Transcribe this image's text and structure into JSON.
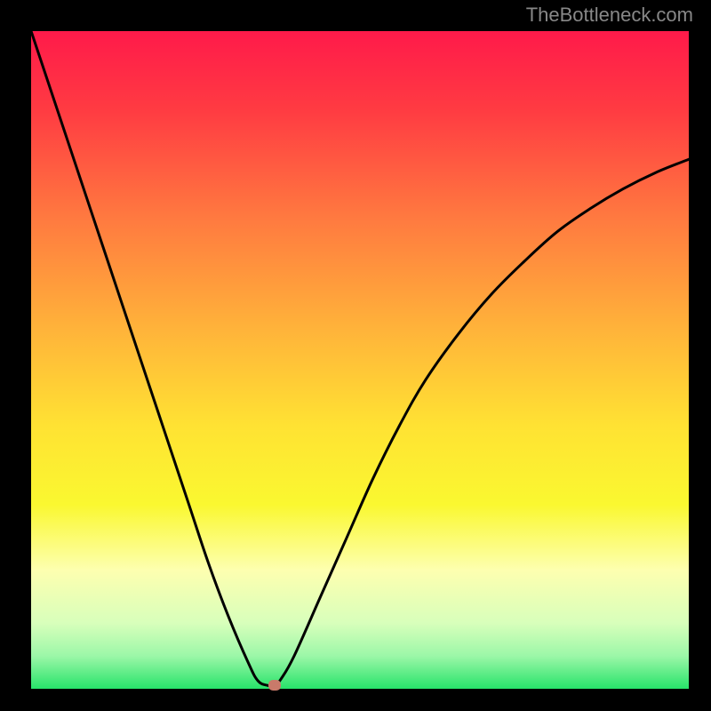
{
  "watermark": "TheBottleneck.com",
  "chart_data": {
    "type": "line",
    "title": "",
    "xlabel": "",
    "ylabel": "",
    "xlim": [
      0,
      100
    ],
    "ylim": [
      0,
      100
    ],
    "gradient_stops": [
      {
        "pos": 0.0,
        "color": "#ff1a4a"
      },
      {
        "pos": 0.12,
        "color": "#ff3b42"
      },
      {
        "pos": 0.28,
        "color": "#ff7840"
      },
      {
        "pos": 0.45,
        "color": "#ffb23a"
      },
      {
        "pos": 0.6,
        "color": "#ffe233"
      },
      {
        "pos": 0.72,
        "color": "#faf830"
      },
      {
        "pos": 0.82,
        "color": "#fdffb0"
      },
      {
        "pos": 0.9,
        "color": "#d8ffbb"
      },
      {
        "pos": 0.95,
        "color": "#9cf7a8"
      },
      {
        "pos": 1.0,
        "color": "#27e36a"
      }
    ],
    "series": [
      {
        "name": "bottleneck-curve",
        "x": [
          0,
          3,
          6,
          9,
          12,
          15,
          18,
          21,
          24,
          27,
          30,
          33,
          34.5,
          36,
          37,
          38,
          40,
          44,
          48,
          52,
          56,
          60,
          65,
          70,
          75,
          80,
          85,
          90,
          95,
          100
        ],
        "y": [
          100,
          91,
          82,
          73,
          64,
          55,
          46,
          37,
          28,
          19,
          11,
          4,
          1.2,
          0.5,
          0.5,
          1.5,
          5,
          14,
          23,
          32,
          40,
          47,
          54,
          60,
          65,
          69.5,
          73,
          76,
          78.5,
          80.5
        ]
      }
    ],
    "marker": {
      "x": 37,
      "y": 0.5,
      "color": "#c97a6a"
    }
  }
}
